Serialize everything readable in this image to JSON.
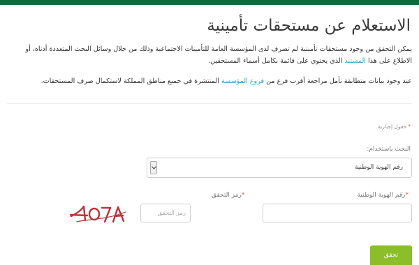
{
  "page": {
    "title": "الاستعلام عن مستحقات تأمينية",
    "intro_part1": "يمكن التحقق من وجود مستحقات تأمينية لم تصرف لدى المؤسسة العامة للتأمينات الاجتماعية وذلك من خلال وسائل البحث المتعددة أدناه، أو الاطلاع على هذا ",
    "intro_link": "المستند",
    "intro_part2": " الذي يحتوي على قائمة بكامل أسماء المستحقين.",
    "notice_part1": "عند وجود بيانات متطابقة نأمل مراجعة أقرب فرع من ",
    "notice_link": "فروع المؤسسة",
    "notice_part2": " المنتشرة في جميع مناطق المملكة لاستكمال صرف المستحقات."
  },
  "form": {
    "required_note": "حقول إجبارية",
    "required_star": "*",
    "search_by_label": "البحث باستخدام:",
    "search_by_selected": "رقم الهوية الوطنية",
    "national_id_label": "رقم الهوية الوطنية",
    "captcha_label": "رمز التحقق",
    "captcha_placeholder": "رمز التحقق",
    "captcha_text": "4O7A",
    "submit_label": "تحقق"
  },
  "colors": {
    "header_green": "#0e6b3a",
    "link_blue": "#2aa3cf",
    "submit_green": "#8cbe2a",
    "required_red": "#d9534f"
  },
  "icons": {
    "select_arrow": "chevron-down-icon"
  }
}
